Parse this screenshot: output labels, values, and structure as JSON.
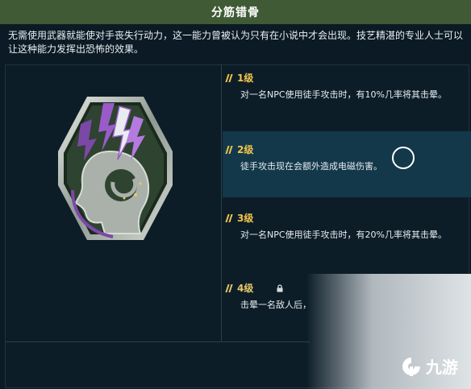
{
  "header": {
    "title": "分筋错骨"
  },
  "description": "无需使用武器就能使对手丧失行动力，这一能力曾被认为只有在小说中才会出现。技艺精湛的专业人士可以让这种能力发挥出恐怖的效果。",
  "levels": [
    {
      "label": "1级",
      "text": "对一名NPC使用徒手攻击时，有10%几率将其击晕。"
    },
    {
      "label": "2级",
      "text": "徒手攻击现在会额外造成电磁伤害。"
    },
    {
      "label": "3级",
      "text": "对一名NPC使用徒手攻击时，有20%几率将其击晕。"
    },
    {
      "label": "4级",
      "text": "击晕一名敌人后，"
    }
  ],
  "icons": {
    "perk": "brain-lightning-emblem-icon",
    "lock": "lock-icon",
    "level_marker": "level-marker-icon"
  },
  "watermark": {
    "text": "九游"
  },
  "colors": {
    "title_bar": "#3f5a34",
    "accent": "#f2c64a",
    "active_row": "#13384a",
    "background": "#0b1a24"
  }
}
